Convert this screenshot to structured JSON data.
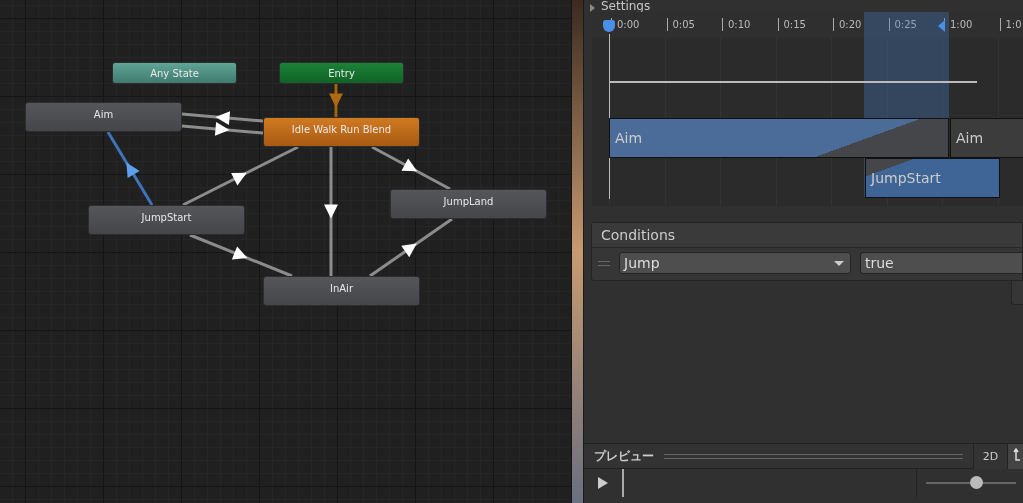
{
  "graph": {
    "states": [
      {
        "label": "Any State",
        "kind": "any"
      },
      {
        "label": "Entry",
        "kind": "entry"
      },
      {
        "label": "Aim",
        "kind": "state"
      },
      {
        "label": "Idle Walk Run Blend",
        "kind": "default"
      },
      {
        "label": "JumpStart",
        "kind": "state"
      },
      {
        "label": "JumpLand",
        "kind": "state"
      },
      {
        "label": "InAir",
        "kind": "state"
      }
    ],
    "transitions": [
      {
        "kind": "entry",
        "selected": false
      },
      {
        "kind": "normal",
        "selected": false
      },
      {
        "kind": "normal",
        "selected": false
      },
      {
        "kind": "normal",
        "selected": true
      },
      {
        "kind": "normal",
        "selected": false
      },
      {
        "kind": "normal",
        "selected": false
      },
      {
        "kind": "normal",
        "selected": false
      },
      {
        "kind": "normal",
        "selected": false
      },
      {
        "kind": "normal",
        "selected": false
      }
    ]
  },
  "inspector": {
    "section_title": "Settings",
    "timeline": {
      "ticks": [
        "0:00",
        "0:05",
        "0:10",
        "0:15",
        "0:20",
        "0:25",
        "1:00",
        "1:0"
      ],
      "clips": [
        {
          "label": "Aim",
          "kind": "source"
        },
        {
          "label": "Aim",
          "kind": "repeat"
        },
        {
          "label": "JumpStart",
          "kind": "destination"
        }
      ]
    },
    "conditions": {
      "title": "Conditions",
      "rows": [
        {
          "parameter": "Jump",
          "value": "true"
        }
      ]
    },
    "preview": {
      "title": "プレビュー",
      "mode_button": "2D",
      "speed_slider": {
        "level": 0.55
      }
    }
  }
}
